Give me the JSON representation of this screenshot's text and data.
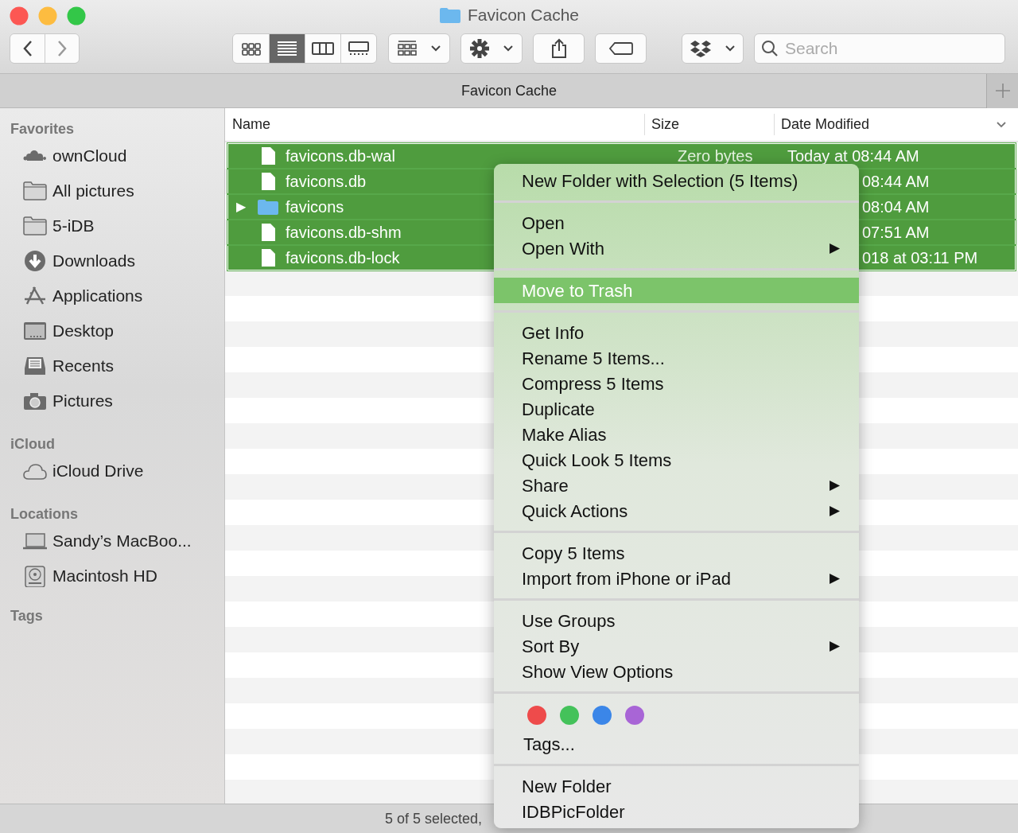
{
  "window": {
    "title": "Favicon Cache"
  },
  "toolbar": {
    "view_modes": [
      {
        "kind": "icons",
        "selected": false
      },
      {
        "kind": "list",
        "selected": true
      },
      {
        "kind": "columns",
        "selected": false
      },
      {
        "kind": "gallery",
        "selected": false
      }
    ],
    "search": {
      "placeholder": "Search"
    }
  },
  "path_bar": {
    "title": "Favicon Cache"
  },
  "sidebar": {
    "sections": [
      {
        "heading": "Favorites",
        "items": [
          {
            "label": "ownCloud",
            "kind": "cloud-dots"
          },
          {
            "label": "All pictures",
            "kind": "folder"
          },
          {
            "label": "5-iDB",
            "kind": "folder"
          },
          {
            "label": "Downloads",
            "kind": "download"
          },
          {
            "label": "Applications",
            "kind": "apps"
          },
          {
            "label": "Desktop",
            "kind": "desktop"
          },
          {
            "label": "Recents",
            "kind": "recents"
          },
          {
            "label": "Pictures",
            "kind": "camera"
          }
        ]
      },
      {
        "heading": "iCloud",
        "items": [
          {
            "label": "iCloud Drive",
            "kind": "cloud"
          }
        ]
      },
      {
        "heading": "Locations",
        "items": [
          {
            "label": "Sandy’s MacBoo...",
            "kind": "laptop"
          },
          {
            "label": "Macintosh HD",
            "kind": "disk"
          }
        ]
      },
      {
        "heading": "Tags"
      }
    ]
  },
  "table": {
    "columns": [
      "Name",
      "Size",
      "Date Modified"
    ],
    "rows": [
      {
        "name": "favicons.db-wal",
        "kind": "file",
        "size": "Zero bytes",
        "date": "Today at 08:44 AM",
        "selected": true
      },
      {
        "name": "favicons.db",
        "kind": "file",
        "date": "08:44 AM",
        "selected": true
      },
      {
        "name": "favicons",
        "kind": "folder",
        "disclosure": "▶",
        "date": "08:04 AM",
        "selected": true
      },
      {
        "name": "favicons.db-shm",
        "kind": "file",
        "date": "07:51 AM",
        "selected": true
      },
      {
        "name": "favicons.db-lock",
        "kind": "file",
        "date": "018 at 03:11 PM",
        "selected": true
      }
    ]
  },
  "context_menu": {
    "groups": [
      {
        "items": [
          {
            "label": "New Folder with Selection (5 Items)",
            "selected": false
          }
        ]
      },
      {
        "items": [
          {
            "label": "Open",
            "selected": false
          },
          {
            "label": "Open With",
            "submenu": "▶",
            "selected": false
          }
        ]
      },
      {
        "items": [
          {
            "label": "Move to Trash",
            "selected": true
          }
        ]
      },
      {
        "items": [
          {
            "label": "Get Info",
            "selected": false
          },
          {
            "label": "Rename 5 Items...",
            "selected": false
          },
          {
            "label": "Compress 5 Items",
            "selected": false
          },
          {
            "label": "Duplicate",
            "selected": false
          },
          {
            "label": "Make Alias",
            "selected": false
          },
          {
            "label": "Quick Look 5 Items",
            "selected": false
          },
          {
            "label": "Share",
            "submenu": "▶",
            "selected": false
          },
          {
            "label": "Quick Actions",
            "submenu": "▶",
            "selected": false
          }
        ]
      },
      {
        "items": [
          {
            "label": "Copy 5 Items",
            "selected": false
          },
          {
            "label": "Import from iPhone or iPad",
            "submenu": "▶",
            "selected": false
          }
        ]
      },
      {
        "items": [
          {
            "label": "Use Groups",
            "selected": false
          },
          {
            "label": "Sort By",
            "submenu": "▶",
            "selected": false
          },
          {
            "label": "Show View Options",
            "selected": false
          }
        ]
      },
      {
        "tags": [
          {
            "color": "#ee4b4b"
          },
          {
            "color": "#44c25a"
          },
          {
            "color": "#3b86e8"
          },
          {
            "color": "#a865d6"
          }
        ],
        "items": [
          {
            "label": "Tags...",
            "selected": false
          }
        ]
      },
      {
        "items": [
          {
            "label": "New Folder",
            "selected": false
          },
          {
            "label": "IDBPicFolder",
            "selected": false
          }
        ]
      }
    ]
  },
  "status_bar": {
    "text": "5 of 5 selected,"
  }
}
